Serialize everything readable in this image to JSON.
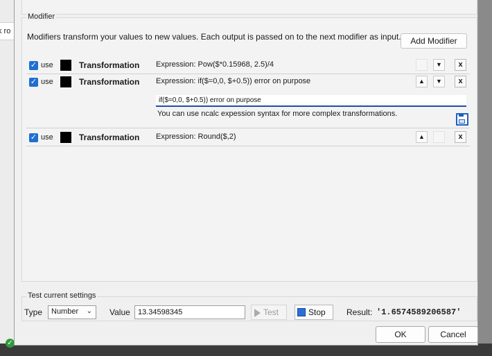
{
  "background": {
    "left_strip_text": "k ro"
  },
  "modifier": {
    "group_title": "Modifier",
    "description": "Modifiers transform your values to new values. Each output is passed on to the next modifier as input.",
    "add_button": "Add Modifier",
    "rows": [
      {
        "use_label": "use",
        "checked": true,
        "color": "#000000",
        "title": "Transformation",
        "expression": "Expression: Pow($*0.15968, 2.5)/4"
      },
      {
        "use_label": "use",
        "checked": true,
        "color": "#000000",
        "title": "Transformation",
        "expression": "Expression: if($=0,0, $+0.5)) error on purpose",
        "editor_value": "if($=0,0, $+0.5)) error on purpose",
        "hint": "You can use ncalc expession syntax for more complex transformations."
      },
      {
        "use_label": "use",
        "checked": true,
        "color": "#000000",
        "title": "Transformation",
        "expression": "Expression: Round($,2)"
      }
    ],
    "up_glyph": "▲",
    "down_glyph": "▼",
    "remove_glyph": "x"
  },
  "test": {
    "group_title": "Test current settings",
    "type_label": "Type",
    "type_value": "Number",
    "value_label": "Value",
    "value_input": "13.34598345",
    "test_button": "Test",
    "stop_button": "Stop",
    "result_label": "Result:",
    "result_value": "'1.6574589206587'"
  },
  "dialog": {
    "ok": "OK",
    "cancel": "Cancel"
  },
  "colors": {
    "accent": "#1f6fd1",
    "focus_underline": "#1f4ea8",
    "ok_check": "#2e9b3a"
  }
}
